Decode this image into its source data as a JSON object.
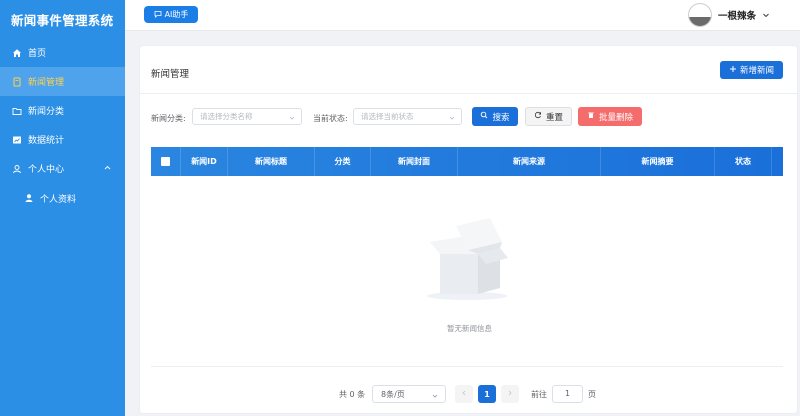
{
  "sidebar": {
    "brand": "新闻事件管理系统",
    "items": [
      {
        "label": "首页",
        "icon": "home-icon"
      },
      {
        "label": "新闻管理",
        "icon": "document-icon",
        "active": true
      },
      {
        "label": "新闻分类",
        "icon": "folder-icon"
      },
      {
        "label": "数据统计",
        "icon": "chart-icon"
      },
      {
        "label": "个人中心",
        "icon": "user-icon",
        "expanded": true
      },
      {
        "label": "个人资料",
        "icon": "user-solid-icon",
        "sub": true
      }
    ]
  },
  "header": {
    "ai_button": "AI助手",
    "username": "一根辣条"
  },
  "main": {
    "title": "新闻管理",
    "add_button": "新增新闻",
    "filters": {
      "category_label": "新闻分类:",
      "category_placeholder": "请选择分类名称",
      "status_label": "当前状态:",
      "status_placeholder": "请选择当前状态"
    },
    "buttons": {
      "search": "搜索",
      "reset": "重置",
      "batch_delete": "批量删除"
    },
    "table": {
      "columns": [
        "新闻ID",
        "新闻标题",
        "分类",
        "新闻封面",
        "新闻来源",
        "新闻摘要",
        "状态"
      ],
      "rows": []
    },
    "empty_text": "暂无新闻信息",
    "pagination": {
      "total": "共 0 条",
      "page_size": "8条/页",
      "current_page": "1",
      "goto_label": "前往",
      "goto_value": "1",
      "page_suffix": "页"
    }
  },
  "colors": {
    "sidebar": "#2b8fe6",
    "primary": "#1a6fd9",
    "danger": "#f56c6c",
    "active_text": "#ffd34d"
  }
}
